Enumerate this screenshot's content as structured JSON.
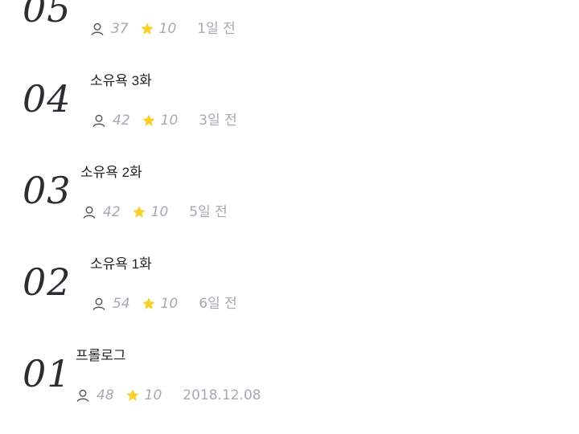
{
  "episodes": [
    {
      "number": "05",
      "title": "",
      "views": "37",
      "rating": "10",
      "date": "1일 전"
    },
    {
      "number": "04",
      "title": "소유욕 3화",
      "views": "42",
      "rating": "10",
      "date": "3일 전"
    },
    {
      "number": "03",
      "title": "소유욕 2화",
      "views": "42",
      "rating": "10",
      "date": "5일 전"
    },
    {
      "number": "02",
      "title": "소유욕 1화",
      "views": "54",
      "rating": "10",
      "date": "6일 전"
    },
    {
      "number": "01",
      "title": "프롤로그",
      "views": "48",
      "rating": "10",
      "date": "2018.12.08"
    }
  ],
  "colors": {
    "number": "#2b2d31",
    "title": "#222222",
    "meta": "#a6a9b0",
    "star": "#f7d12a"
  },
  "icons": {
    "views": "user-icon",
    "rating": "star-icon"
  }
}
